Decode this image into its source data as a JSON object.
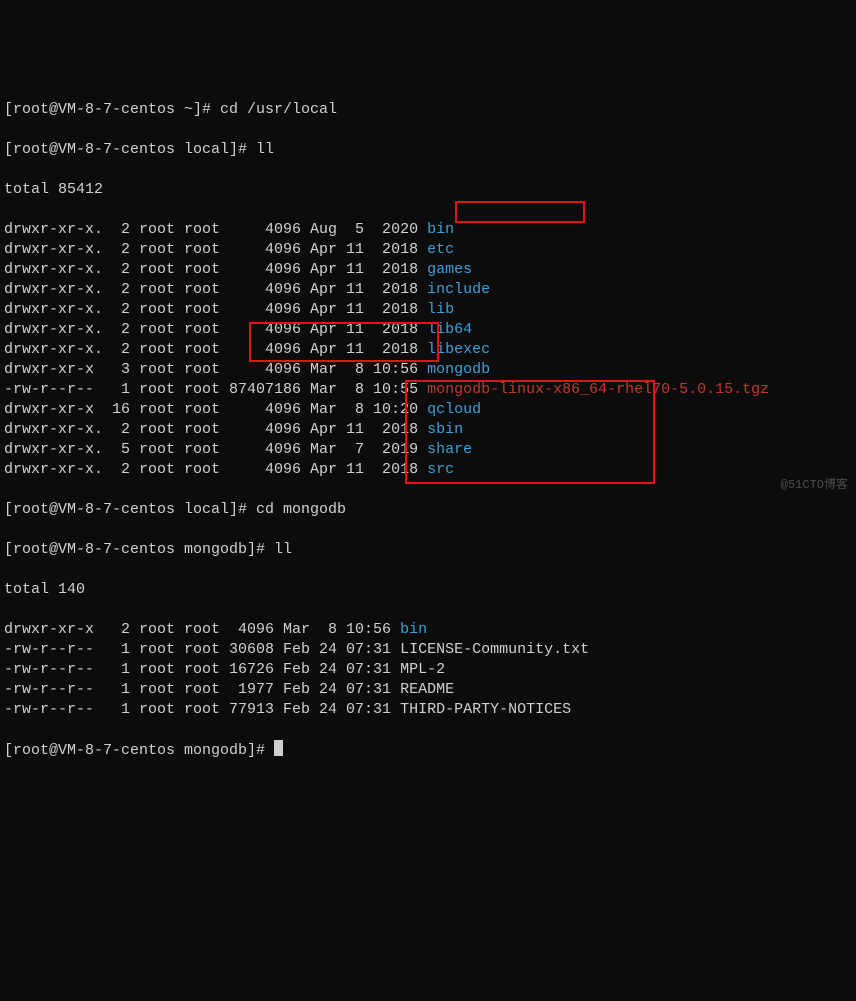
{
  "host": "VM-8-7-centos",
  "user": "root",
  "prompts": {
    "p0": "[root@VM-8-7-centos ~]# cd /usr/local",
    "p1": "[root@VM-8-7-centos local]# ll",
    "p2": "[root@VM-8-7-centos local]# cd mongodb",
    "p3": "[root@VM-8-7-centos mongodb]# ll",
    "p4": "[root@VM-8-7-centos mongodb]# "
  },
  "totals": {
    "local": "total 85412",
    "mongodb": "total 140"
  },
  "ls_local": [
    {
      "perm": "drwxr-xr-x.",
      "links": "2",
      "owner": "root",
      "group": "root",
      "size": "4096",
      "date": "Aug  5  2020",
      "name": "bin",
      "type": "dir"
    },
    {
      "perm": "drwxr-xr-x.",
      "links": "2",
      "owner": "root",
      "group": "root",
      "size": "4096",
      "date": "Apr 11  2018",
      "name": "etc",
      "type": "dir"
    },
    {
      "perm": "drwxr-xr-x.",
      "links": "2",
      "owner": "root",
      "group": "root",
      "size": "4096",
      "date": "Apr 11  2018",
      "name": "games",
      "type": "dir"
    },
    {
      "perm": "drwxr-xr-x.",
      "links": "2",
      "owner": "root",
      "group": "root",
      "size": "4096",
      "date": "Apr 11  2018",
      "name": "include",
      "type": "dir"
    },
    {
      "perm": "drwxr-xr-x.",
      "links": "2",
      "owner": "root",
      "group": "root",
      "size": "4096",
      "date": "Apr 11  2018",
      "name": "lib",
      "type": "dir"
    },
    {
      "perm": "drwxr-xr-x.",
      "links": "2",
      "owner": "root",
      "group": "root",
      "size": "4096",
      "date": "Apr 11  2018",
      "name": "lib64",
      "type": "dir"
    },
    {
      "perm": "drwxr-xr-x.",
      "links": "2",
      "owner": "root",
      "group": "root",
      "size": "4096",
      "date": "Apr 11  2018",
      "name": "libexec",
      "type": "dir"
    },
    {
      "perm": "drwxr-xr-x",
      "links": "3",
      "owner": "root",
      "group": "root",
      "size": "4096",
      "date": "Mar  8 10:56",
      "name": "mongodb",
      "type": "dir"
    },
    {
      "perm": "-rw-r--r--",
      "links": "1",
      "owner": "root",
      "group": "root",
      "size": "87407186",
      "date": "Mar  8 10:55",
      "name": "mongodb-linux-x86_64-rhel70-5.0.15.tgz",
      "type": "archive"
    },
    {
      "perm": "drwxr-xr-x",
      "links": "16",
      "owner": "root",
      "group": "root",
      "size": "4096",
      "date": "Mar  8 10:20",
      "name": "qcloud",
      "type": "dir"
    },
    {
      "perm": "drwxr-xr-x.",
      "links": "2",
      "owner": "root",
      "group": "root",
      "size": "4096",
      "date": "Apr 11  2018",
      "name": "sbin",
      "type": "dir"
    },
    {
      "perm": "drwxr-xr-x.",
      "links": "5",
      "owner": "root",
      "group": "root",
      "size": "4096",
      "date": "Mar  7  2019",
      "name": "share",
      "type": "dir"
    },
    {
      "perm": "drwxr-xr-x.",
      "links": "2",
      "owner": "root",
      "group": "root",
      "size": "4096",
      "date": "Apr 11  2018",
      "name": "src",
      "type": "dir"
    }
  ],
  "ls_mongodb": [
    {
      "perm": "drwxr-xr-x",
      "links": "2",
      "owner": "root",
      "group": "root",
      "size": "4096",
      "date": "Mar  8 10:56",
      "name": "bin",
      "type": "dir"
    },
    {
      "perm": "-rw-r--r--",
      "links": "1",
      "owner": "root",
      "group": "root",
      "size": "30608",
      "date": "Feb 24 07:31",
      "name": "LICENSE-Community.txt",
      "type": "file"
    },
    {
      "perm": "-rw-r--r--",
      "links": "1",
      "owner": "root",
      "group": "root",
      "size": "16726",
      "date": "Feb 24 07:31",
      "name": "MPL-2",
      "type": "file"
    },
    {
      "perm": "-rw-r--r--",
      "links": "1",
      "owner": "root",
      "group": "root",
      "size": "1977",
      "date": "Feb 24 07:31",
      "name": "README",
      "type": "file"
    },
    {
      "perm": "-rw-r--r--",
      "links": "1",
      "owner": "root",
      "group": "root",
      "size": "77913",
      "date": "Feb 24 07:31",
      "name": "THIRD-PARTY-NOTICES",
      "type": "file"
    }
  ],
  "watermark": "@51CTO博客"
}
